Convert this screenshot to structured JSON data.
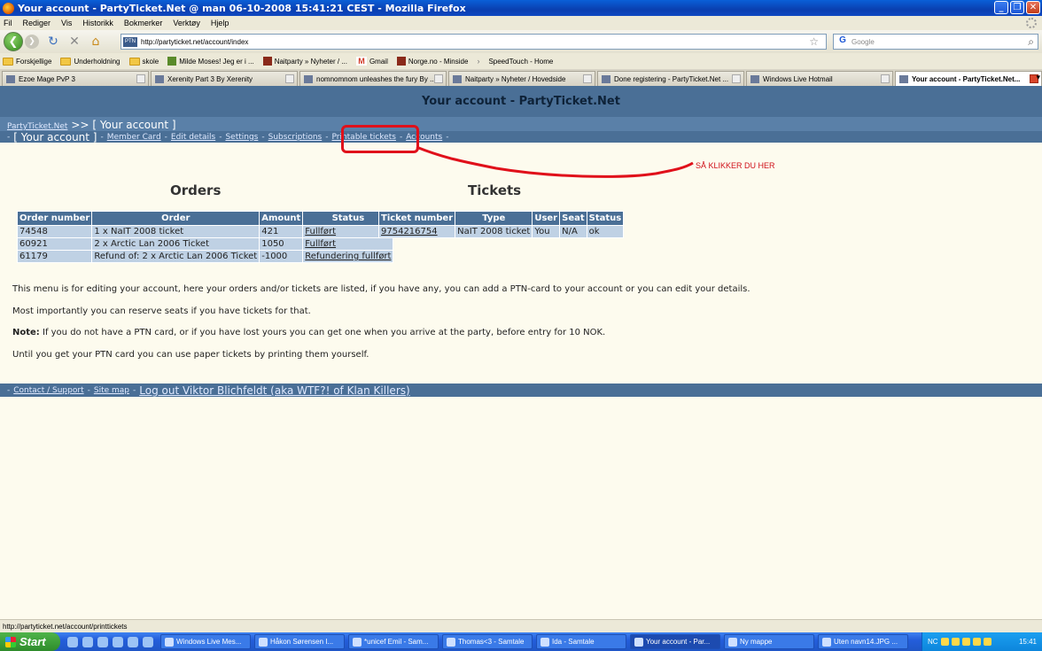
{
  "window": {
    "title": "Your account - PartyTicket.Net @ man 06-10-2008 15:41:21 CEST - Mozilla Firefox"
  },
  "menu": [
    "Fil",
    "Rediger",
    "Vis",
    "Historikk",
    "Bokmerker",
    "Verktøy",
    "Hjelp"
  ],
  "navbar": {
    "url": "http://partyticket.net/account/index",
    "favicon_text": "PTN",
    "search_placeholder": "Google"
  },
  "bookmarks": [
    {
      "label": "Forskjellige",
      "icon": "folder-icon"
    },
    {
      "label": "Underholdning",
      "icon": "folder-icon"
    },
    {
      "label": "skole",
      "icon": "folder-icon"
    },
    {
      "label": "Milde Moses! Jeg er i ...",
      "icon": "page-icon"
    },
    {
      "label": "Naitparty » Nyheter / ...",
      "icon": "page-icon"
    },
    {
      "label": "Gmail",
      "icon": "gmail-icon"
    },
    {
      "label": "Norge.no - Minside",
      "icon": "page-icon"
    },
    {
      "label": "SpeedTouch - Home",
      "icon": "page-icon"
    }
  ],
  "tabs": [
    {
      "label": "Ezoe Mage PvP 3",
      "active": false
    },
    {
      "label": "Xerenity Part 3 By Xerenity",
      "active": false
    },
    {
      "label": "nomnomnom unleashes the fury By ...",
      "active": false
    },
    {
      "label": "Naitparty » Nyheter / Hovedside",
      "active": false
    },
    {
      "label": "Done registering - PartyTicket.Net ...",
      "active": false
    },
    {
      "label": "Windows Live Hotmail",
      "active": false
    },
    {
      "label": "Your account - PartyTicket.Net...",
      "active": true
    }
  ],
  "page": {
    "header": "Your account - PartyTicket.Net",
    "breadcrumb": {
      "home": "PartyTicket.Net",
      "sep": ">>",
      "current": "[ Your account ]"
    },
    "subnav": {
      "current": "[ Your account ]",
      "links": [
        "Member Card",
        "Edit details",
        "Settings",
        "Subscriptions",
        "Printable tickets",
        "Accounts"
      ]
    },
    "orders": {
      "title": "Orders",
      "headers": [
        "Order number",
        "Order",
        "Amount",
        "Status"
      ],
      "rows": [
        [
          "74548",
          "1 x NaIT 2008 ticket",
          "421",
          "Fullført"
        ],
        [
          "60921",
          "2 x Arctic Lan 2006 Ticket",
          "1050",
          "Fullført"
        ],
        [
          "61179",
          "Refund of: 2 x Arctic Lan 2006 Ticket",
          "-1000",
          "Refundering fullført"
        ]
      ]
    },
    "tickets": {
      "title": "Tickets",
      "headers": [
        "Ticket number",
        "Type",
        "User",
        "Seat",
        "Status"
      ],
      "rows": [
        [
          "9754216754",
          "NaIT 2008 ticket",
          "You",
          "N/A",
          "ok"
        ]
      ]
    },
    "paragraphs": {
      "p1": "This menu is for editing your account, here your orders and/or tickets are listed, if you have any, you can add a PTN-card to your account or you can edit your details.",
      "p2": "Most importantly you can reserve seats if you have tickets for that.",
      "p3_bold": "Note:",
      "p3": " If you do not have a PTN card, or if you have lost yours you can get one when you arrive at the party, before entry for 10 NOK.",
      "p4": "Until you get your PTN card you can use paper tickets by printing them yourself."
    },
    "footer": {
      "contact": "Contact / Support",
      "sitemap": "Site map",
      "logout": "Log out Viktor Blichfeldt (aka WTF?! of Klan Killers)"
    },
    "annotation": "SÅ KLIKKER DU HER"
  },
  "statusbar": {
    "text": "http://partyticket.net/account/printtickets"
  },
  "taskbar": {
    "start": "Start",
    "items": [
      {
        "label": "Windows Live Mes...",
        "active": false
      },
      {
        "label": "Håkon Sørensen I...",
        "active": false
      },
      {
        "label": "*unicef Emil - Sam...",
        "active": false
      },
      {
        "label": "Thomas<3 - Samtale",
        "active": false
      },
      {
        "label": "Ida - Samtale",
        "active": false
      },
      {
        "label": "Your account - Par...",
        "active": true
      },
      {
        "label": "Ny mappe",
        "active": false
      },
      {
        "label": "Uten navn14.JPG ...",
        "active": false
      }
    ],
    "lang": "NC",
    "clock": "15:41"
  }
}
